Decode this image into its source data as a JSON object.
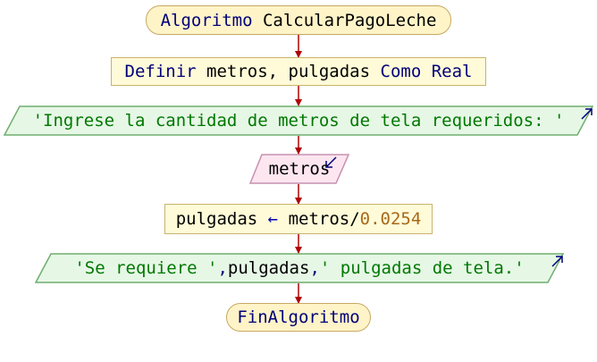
{
  "diagram": {
    "start": {
      "keyword": "Algoritmo",
      "name": "CalcularPagoLeche"
    },
    "define": {
      "keyword": "Definir",
      "vars": "metros, pulgadas",
      "as_keyword": "Como",
      "type": "Real"
    },
    "output1": {
      "text": "'Ingrese la cantidad de metros de tela requeridos: '"
    },
    "input1": {
      "var": "metros"
    },
    "assign": {
      "target": "pulgadas",
      "arrow": "←",
      "expr": "metros/",
      "number": "0.0254"
    },
    "output2": {
      "str1": "'Se requiere '",
      "sep1": ",",
      "var": " pulgadas",
      "sep2": ",",
      "str2": " ' pulgadas de tela.'"
    },
    "end": {
      "keyword": "FinAlgoritmo"
    }
  },
  "colors": {
    "terminal_fill": "#fff4c8",
    "process_fill": "#fffbd8",
    "output_fill": "#e6f7e6",
    "input_fill": "#fde6f0",
    "arrow": "#b00000",
    "keyword": "#00007a",
    "string": "#007800",
    "number": "#a8681a"
  }
}
